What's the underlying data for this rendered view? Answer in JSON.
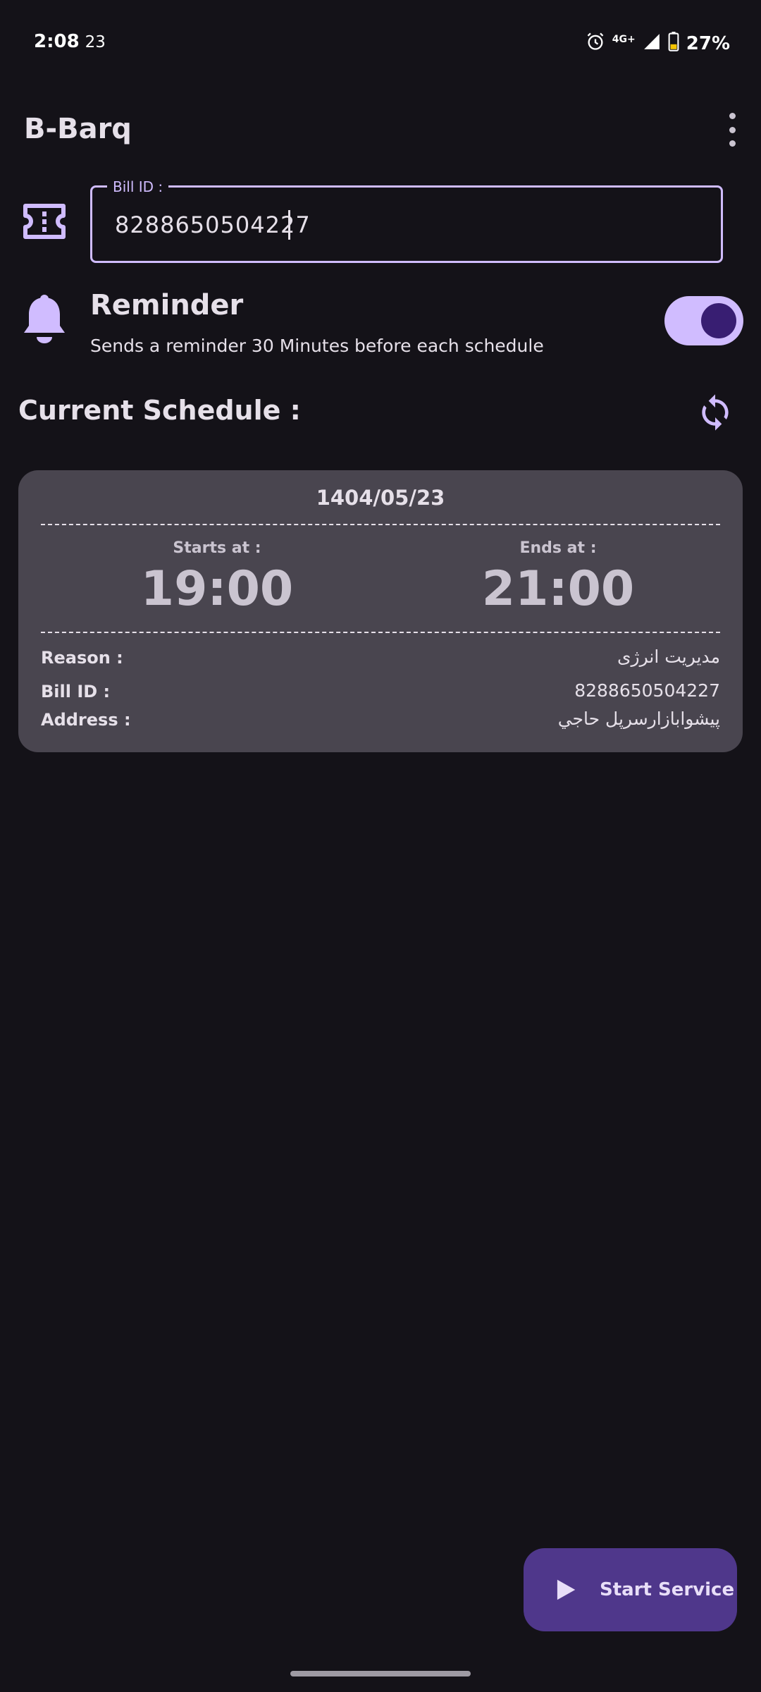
{
  "status_bar": {
    "time": "2:08",
    "seconds": "23",
    "network": "4G+",
    "battery": "27%"
  },
  "app_bar": {
    "title": "B-Barq"
  },
  "bill_field": {
    "label": "Bill ID :",
    "value": "8288650504227"
  },
  "reminder": {
    "title": "Reminder",
    "subtitle": "Sends a reminder 30 Minutes before each schedule",
    "enabled": true
  },
  "schedule": {
    "title": "Current Schedule :",
    "date": "1404/05/23",
    "starts_label": "Starts at :",
    "starts_value": "19:00",
    "ends_label": "Ends at :",
    "ends_value": "21:00",
    "reason_label": "Reason :",
    "reason_value": "مدیریت انرژی",
    "bill_label": "Bill ID :",
    "bill_value": "8288650504227",
    "address_label": "Address :",
    "address_value": "پیشوابازارسرپل حاجي"
  },
  "fab": {
    "label": "Start Service"
  },
  "colors": {
    "background": "#141218",
    "accent": "#d0bcff",
    "card": "#49454f",
    "fab": "#4f378b"
  }
}
